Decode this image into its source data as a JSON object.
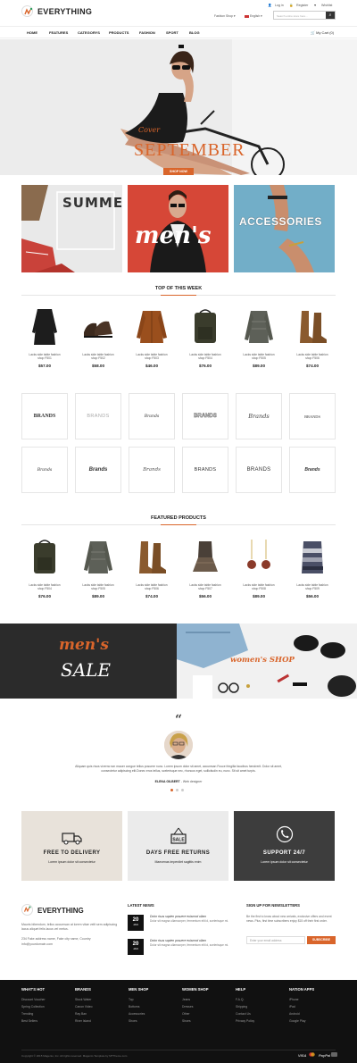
{
  "header": {
    "logo_text": "EVERYTHING",
    "login": "Log in",
    "register": "Register",
    "wishlist": "Wishlist",
    "store_select": "Fashion Shop",
    "language_select": "English",
    "search_placeholder": "Search entire store here..."
  },
  "nav": {
    "items": [
      "HOME",
      "FEATURES",
      "CATEGORYS",
      "PRODUCTS",
      "FASHION",
      "SPORT",
      "BLOG"
    ],
    "cart": "My Cart (0)"
  },
  "hero": {
    "subtitle": "Cover",
    "title": "SEPTEMBER",
    "button": "SHOP NOW"
  },
  "banners": {
    "summer": "SUMMER",
    "mens": "men's",
    "accessories": "ACCESSORIES"
  },
  "top_week": {
    "title": "TOP OF THIS WEEK",
    "products": [
      {
        "name_line1": "Lacks side table fashion",
        "name_line2": "shop F501",
        "price": "$57.00"
      },
      {
        "name_line1": "Lacks side table fashion",
        "name_line2": "shop F502",
        "price": "$58.00"
      },
      {
        "name_line1": "Lacks side table fashion",
        "name_line2": "shop F503",
        "price": "$46.00"
      },
      {
        "name_line1": "Lacks side table fashion",
        "name_line2": "shop F504",
        "price": "$76.00"
      },
      {
        "name_line1": "Lacks side table fashion",
        "name_line2": "shop F505",
        "price": "$89.00"
      },
      {
        "name_line1": "Lacks side table fashion",
        "name_line2": "shop F506",
        "price": "$74.00"
      }
    ]
  },
  "brands": {
    "row1": [
      "BRANDS",
      "BRANDS",
      "Brands",
      "BRANDS",
      "Brands",
      "BRANDS"
    ],
    "row2": [
      "Brands",
      "Brands",
      "Brands",
      "BRANDS",
      "BRANDS",
      "Brands"
    ]
  },
  "featured": {
    "title": "FEATURED PRODUCTS",
    "products": [
      {
        "name_line1": "Lacks side table fashion",
        "name_line2": "shop F504",
        "price": "$76.00"
      },
      {
        "name_line1": "Lacks side table fashion",
        "name_line2": "shop F505",
        "price": "$89.00"
      },
      {
        "name_line1": "Lacks side table fashion",
        "name_line2": "shop F506",
        "price": "$74.00"
      },
      {
        "name_line1": "Lacks side table fashion",
        "name_line2": "shop F507",
        "price": "$56.00"
      },
      {
        "name_line1": "Lacks side table fashion",
        "name_line2": "shop F508",
        "price": "$89.00"
      },
      {
        "name_line1": "Lacks side table fashion",
        "name_line2": "shop F509",
        "price": "$56.00"
      }
    ]
  },
  "sale_banners": {
    "mens_script": "men's",
    "mens_sale": "SALE",
    "womens": "women's SHOP"
  },
  "testimonial": {
    "quote_mark": "“",
    "text_line1": "Aliquam quis risus viverra non mauer congue tellus posuere nunc. Lorem ipsum dolor sit amet, accumsan Fusce fringilla faucibus hendrerit. Dolor sit amet,",
    "text_line2": "consectetur adipiscing elit.Donec eros tellus, scelerisque nec, rhoncus eget, sollicitudin eu, nunc. Sit sit amet turpis.",
    "author": "ELENA GILBERT",
    "role": "- Web designer"
  },
  "services": [
    {
      "title": "FREE TO DELIVERY",
      "subtitle": "Lorem ipsum dolor sit consectetur",
      "icon": "truck-icon",
      "bg": "#e8e2da",
      "fg": "#222"
    },
    {
      "title": "DAYS FREE RETURNS",
      "subtitle": "Maecenas imperdiet sagittis enim",
      "icon": "sale-sign-icon",
      "bg": "#ebebeb",
      "fg": "#222"
    },
    {
      "title": "SUPPORT 24/7",
      "subtitle": "Lorem ipsum dolor sit consectetur",
      "icon": "phone-icon",
      "bg": "#3d3d3d",
      "fg": "#fff"
    }
  ],
  "footer_about": {
    "logo_text": "EVERYTHING",
    "desc_line1": "Mauris bibendum, tellus accumsan at lorem vitae velit sem adipiscing",
    "desc_line2": "lacus aliquet felis lacus vel metus.",
    "address": "234 Fake address name, Fake city name, Country",
    "email": "info@yourdomain.com"
  },
  "latest_news": {
    "title": "LATEST NEWS",
    "items": [
      {
        "day": "20",
        "month": "JAN",
        "headline": "Dolor risus sapien posuere euismod ullam",
        "body": "Dolor sit magna ullamcorper, fermentum elit id, scelerisque mi."
      },
      {
        "day": "20",
        "month": "JAN",
        "headline": "Dolor risus sapien posuere euismod ullam",
        "body": "Dolor sit magna ullamcorper, fermentum elit id, scelerisque mi."
      }
    ]
  },
  "newsletter": {
    "title": "SIGN UP FOR NEWSLETTERS",
    "desc": "Be the first to know about new arrivals, exclusive offers and event news. Plus, first time subscribers enjoy $15 off their first order.",
    "placeholder": "Enter your email address",
    "button": "SUBSCRIBE"
  },
  "footer_links": [
    {
      "heading": "WHAT'S HOT",
      "links": [
        "Discount Voucher",
        "Spring Collection",
        "Trending",
        "Best Sellers"
      ]
    },
    {
      "heading": "BRANDS",
      "links": [
        "Stock Water",
        "Canon Video",
        "Ray Ban",
        "River Island"
      ]
    },
    {
      "heading": "MEN SHOP",
      "links": [
        "Top",
        "Bottoms",
        "Accessories",
        "Shoes"
      ]
    },
    {
      "heading": "WOMEN SHOP",
      "links": [
        "Jeans",
        "Dresses",
        "Other",
        "Shoes"
      ]
    },
    {
      "heading": "HELP",
      "links": [
        "F.A.Q.",
        "Shipping",
        "Contact Us",
        "Privacy Policy"
      ]
    },
    {
      "heading": "NATION APPS",
      "links": [
        "iPhone",
        "iPad",
        "Android",
        "Google Play"
      ]
    }
  ],
  "copyright": "Copyright © 2015 Magento, Inc. All rights reserved. Magento Template by MTTheme.com",
  "payments": [
    "VISA",
    "PayPal"
  ],
  "colors": {
    "accent": "#d9652b",
    "dark": "#111111"
  }
}
